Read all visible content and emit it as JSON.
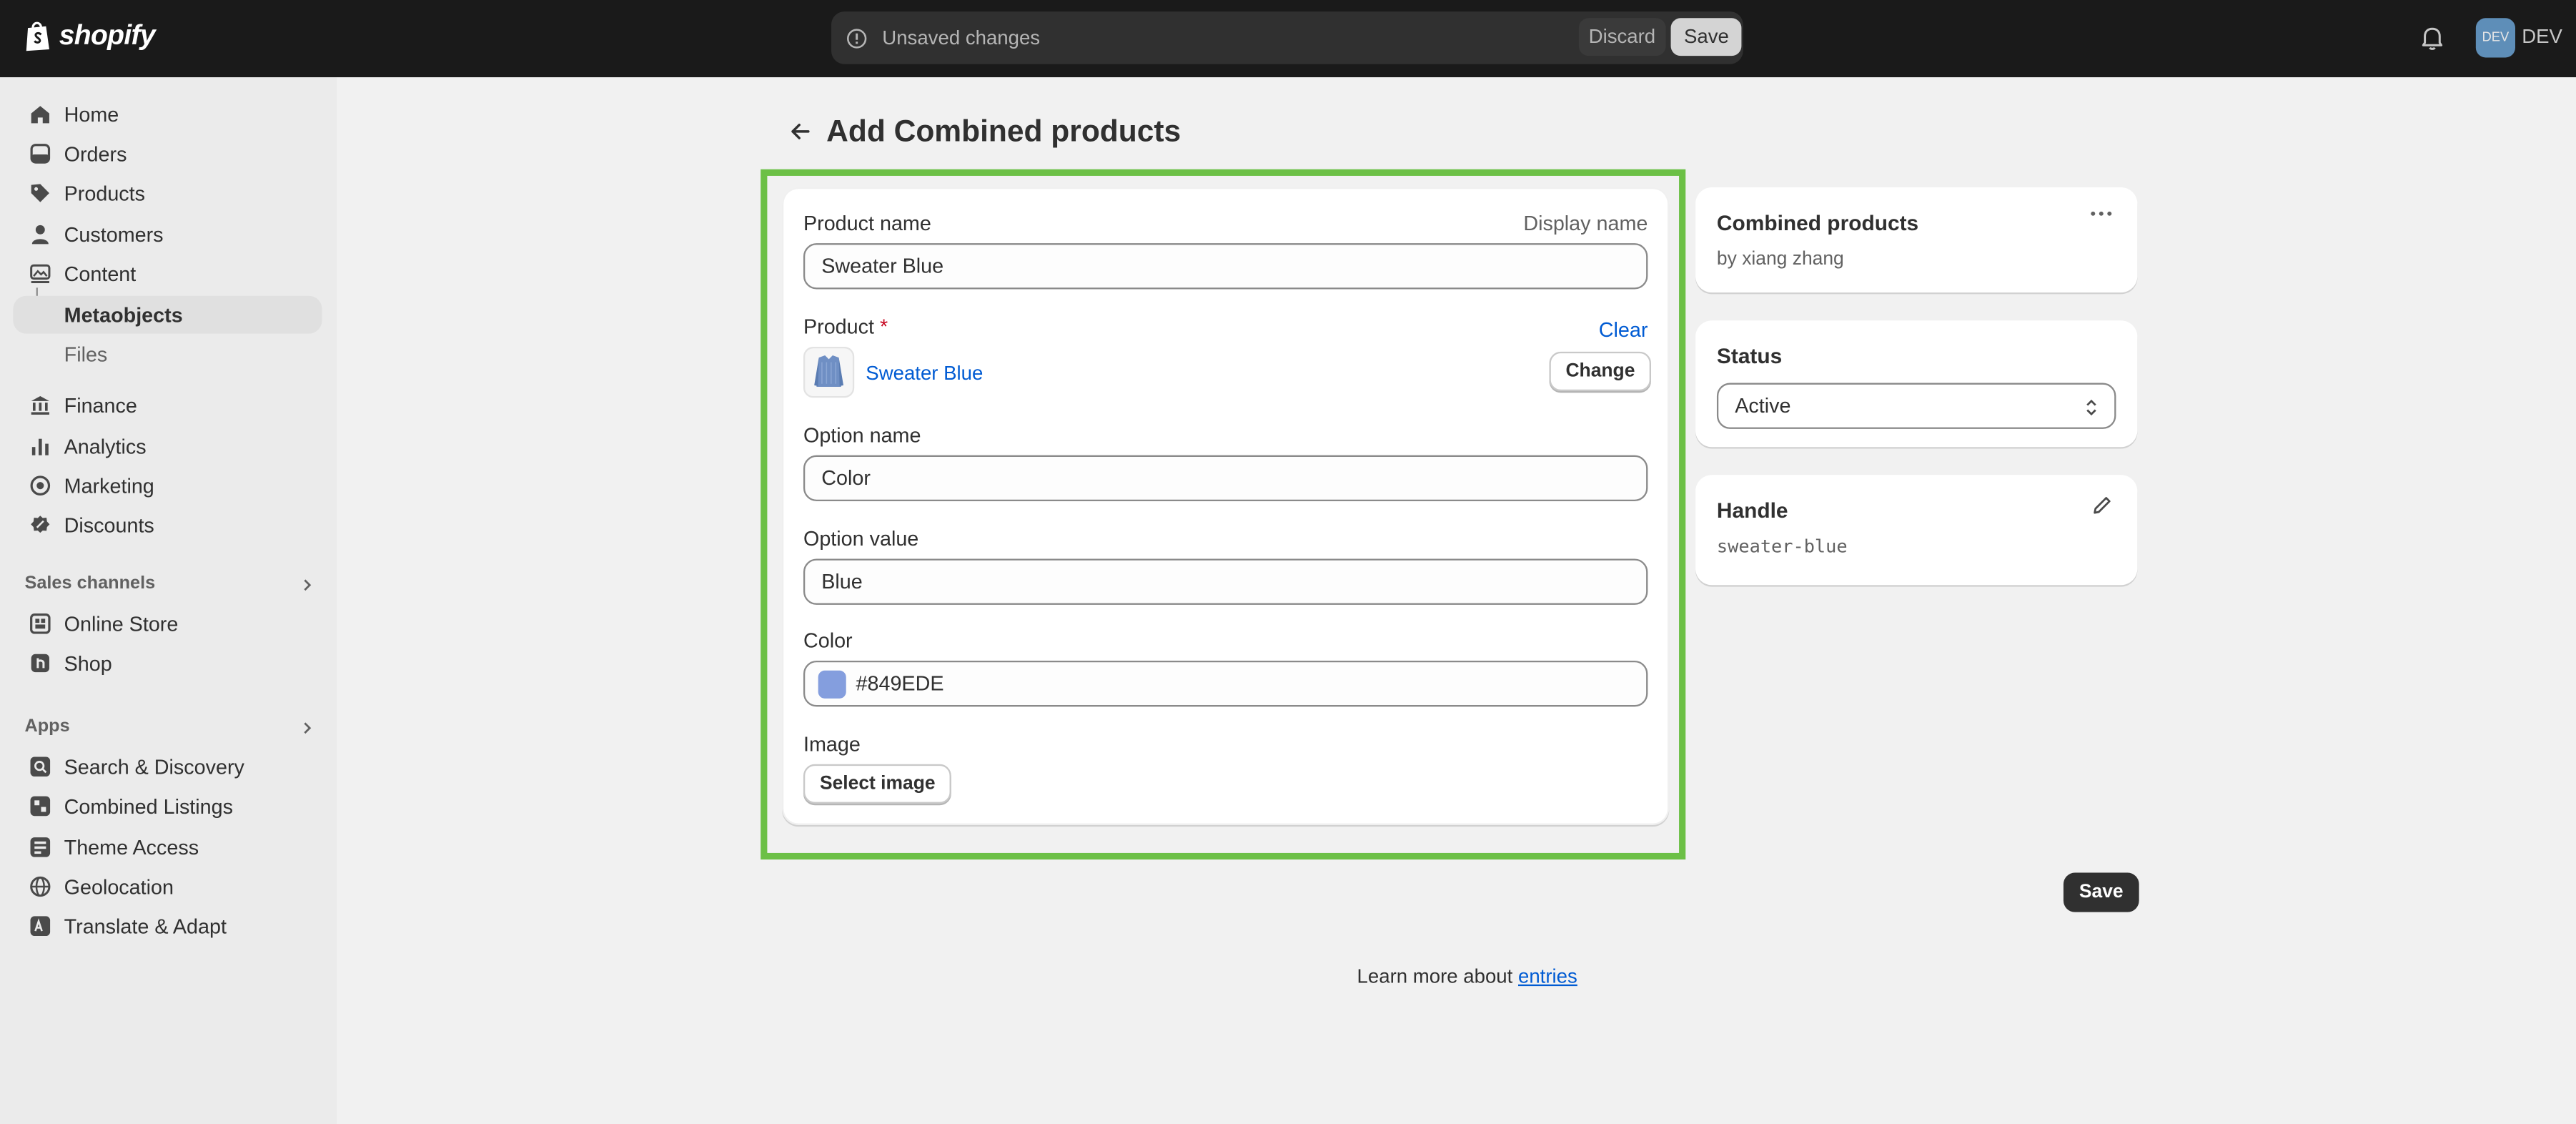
{
  "topbar": {
    "brand": "shopify",
    "unsaved_label": "Unsaved changes",
    "discard_label": "Discard",
    "save_label": "Save",
    "avatar_initials": "DEV",
    "store_name": "DEV"
  },
  "sidebar": {
    "items": [
      {
        "label": "Home",
        "icon": "home-icon"
      },
      {
        "label": "Orders",
        "icon": "orders-icon"
      },
      {
        "label": "Products",
        "icon": "tag-icon"
      },
      {
        "label": "Customers",
        "icon": "person-icon"
      },
      {
        "label": "Content",
        "icon": "content-icon"
      },
      {
        "label": "Metaobjects"
      },
      {
        "label": "Files"
      },
      {
        "label": "Finance",
        "icon": "bank-icon"
      },
      {
        "label": "Analytics",
        "icon": "bar-chart-icon"
      },
      {
        "label": "Marketing",
        "icon": "target-icon"
      },
      {
        "label": "Discounts",
        "icon": "discount-icon"
      }
    ],
    "sales_channels_heading": "Sales channels",
    "sales_channels": [
      {
        "label": "Online Store",
        "icon": "store-icon"
      },
      {
        "label": "Shop",
        "icon": "shop-icon"
      }
    ],
    "apps_heading": "Apps",
    "apps": [
      {
        "label": "Search & Discovery",
        "icon": "app-icon"
      },
      {
        "label": "Combined Listings",
        "icon": "app-icon"
      },
      {
        "label": "Theme Access",
        "icon": "app-icon"
      },
      {
        "label": "Geolocation",
        "icon": "globe-icon"
      },
      {
        "label": "Translate & Adapt",
        "icon": "app-icon"
      }
    ]
  },
  "page": {
    "title": "Add Combined products"
  },
  "form": {
    "product_name_label": "Product name",
    "display_name_label": "Display name",
    "product_name_value": "Sweater Blue",
    "product_label": "Product",
    "required_mark": "*",
    "clear_label": "Clear",
    "product_link": "Sweater Blue",
    "change_label": "Change",
    "option_name_label": "Option name",
    "option_name_value": "Color",
    "option_value_label": "Option value",
    "option_value_value": "Blue",
    "color_label": "Color",
    "color_value": "#849EDE",
    "image_label": "Image",
    "select_image_label": "Select image"
  },
  "side": {
    "definition_title": "Combined products",
    "definition_author": "by xiang zhang",
    "status_title": "Status",
    "status_value": "Active",
    "handle_title": "Handle",
    "handle_value": "sweater-blue"
  },
  "footer": {
    "save_label": "Save",
    "learn_prefix": "Learn more about",
    "learn_link": "entries"
  },
  "colors": {
    "highlight": "#6cc046",
    "swatch": "#849EDE",
    "link": "#005bd3"
  }
}
